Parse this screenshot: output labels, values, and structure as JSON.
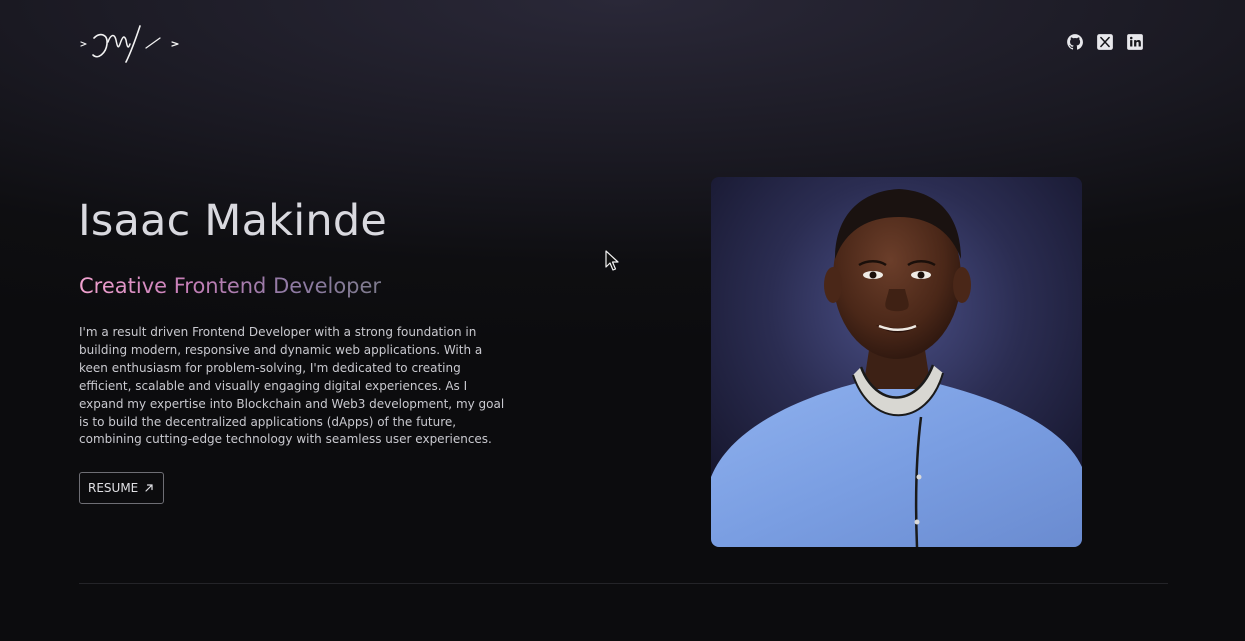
{
  "header": {
    "logo_text": "<JM/>",
    "social_links": [
      {
        "name": "GitHub",
        "icon": "github-icon"
      },
      {
        "name": "X",
        "icon": "x-icon"
      },
      {
        "name": "LinkedIn",
        "icon": "linkedin-icon"
      }
    ]
  },
  "hero": {
    "name": "Isaac Makinde",
    "role": "Creative Frontend Developer",
    "bio": "I'm a result driven Frontend Developer with a strong foundation in building modern, responsive and dynamic web applications. With a keen enthusiasm for problem-solving, I'm dedicated to creating efficient, scalable and visually engaging digital experiences. As I expand my expertise into Blockchain and Web3 development, my goal is to build the decentralized applications (dApps) of the future, combining cutting-edge technology with seamless user experiences.",
    "resume_label": "RESUME",
    "portrait_alt": "Isaac Makinde"
  },
  "colors": {
    "background": "#0c0c0e",
    "role_gradient_start": "#f2a3d0",
    "role_gradient_end": "#7d7a8c",
    "text": "#d9d9df"
  }
}
